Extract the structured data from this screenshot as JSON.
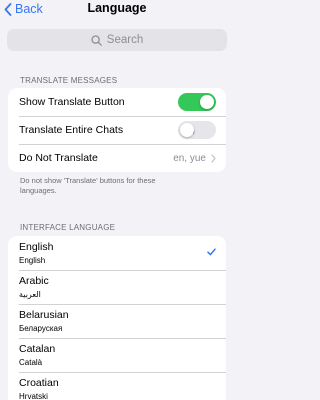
{
  "nav": {
    "back_label": "Back",
    "title": "Language"
  },
  "search": {
    "placeholder": "Search"
  },
  "translate_section": {
    "header": "TRANSLATE MESSAGES",
    "rows": [
      {
        "label": "Show Translate Button",
        "toggle": "on"
      },
      {
        "label": "Translate Entire Chats",
        "toggle": "off",
        "locked": true
      },
      {
        "label": "Do Not Translate",
        "value": "en, yue"
      }
    ],
    "footer": "Do not show 'Translate' buttons for these languages."
  },
  "interface_section": {
    "header": "INTERFACE LANGUAGE",
    "languages": [
      {
        "name": "English",
        "native": "English",
        "selected": true
      },
      {
        "name": "Arabic",
        "native": "العربية",
        "selected": false
      },
      {
        "name": "Belarusian",
        "native": "Беларуская",
        "selected": false
      },
      {
        "name": "Catalan",
        "native": "Català",
        "selected": false
      },
      {
        "name": "Croatian",
        "native": "Hrvatski",
        "selected": false
      }
    ]
  },
  "colors": {
    "accent": "#3478f6",
    "toggle_on": "#34c759",
    "background": "#f2f2f7"
  }
}
